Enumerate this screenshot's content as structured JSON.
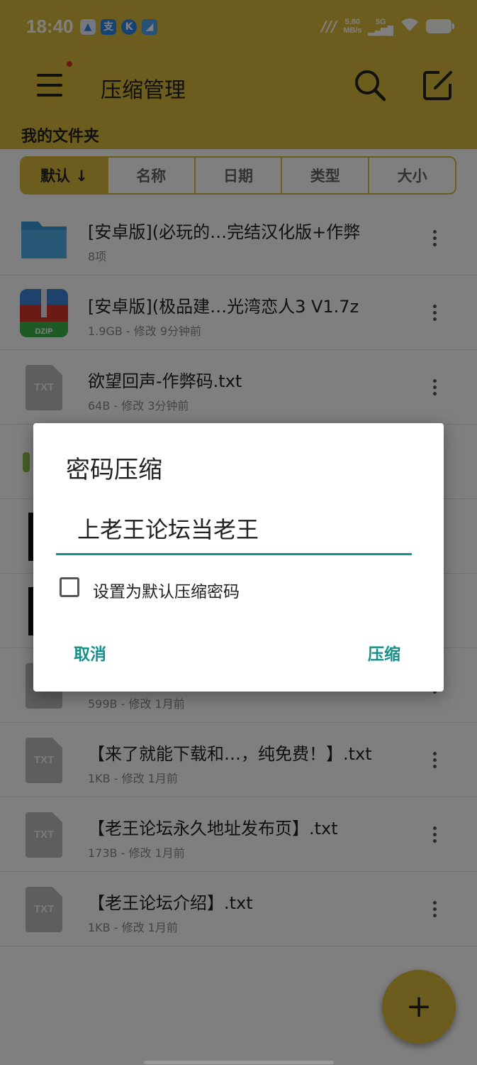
{
  "status_bar": {
    "time": "18:40",
    "apps": [
      "app-icon-1",
      "支",
      "K",
      "app-icon-4"
    ],
    "net_speed": "5.80",
    "net_unit": "MB/s",
    "signal": "5G"
  },
  "toolbar": {
    "title": "压缩管理",
    "menu_icon": "hamburger-icon",
    "search_icon": "search-icon",
    "edit_icon": "edit-icon"
  },
  "section_title": "我的文件夹",
  "sort_tabs": [
    "默认 ↓",
    "名称",
    "日期",
    "类型",
    "大小"
  ],
  "files": [
    {
      "name": "[安卓版](必玩的…完结汉化版+作弊",
      "meta": "8项",
      "type": "folder"
    },
    {
      "name": "[安卓版](极品建…光湾恋人3 V1.7z",
      "meta": "1.9GB - 修改 9分钟前",
      "type": "zip"
    },
    {
      "name": "欲望回声-作弊码.txt",
      "meta": "64B - 修改 3分钟前",
      "type": "txt"
    },
    {
      "name": "",
      "meta": "599B - 修改 1月前",
      "type": "txt"
    },
    {
      "name": "【来了就能下载和…，纯免费！】.txt",
      "meta": "1KB - 修改 1月前",
      "type": "txt"
    },
    {
      "name": "【老王论坛永久地址发布页】.txt",
      "meta": "173B - 修改 1月前",
      "type": "txt"
    },
    {
      "name": "【老王论坛介绍】.txt",
      "meta": "1KB - 修改 1月前",
      "type": "txt"
    }
  ],
  "zip_label": "DZIP",
  "txt_label": "TXT",
  "fab_label": "+",
  "dialog": {
    "title": "密码压缩",
    "password": "上老王论坛当老王",
    "checkbox_label": "设置为默认压缩密码",
    "checkbox_checked": false,
    "cancel": "取消",
    "confirm": "压缩"
  },
  "colors": {
    "accent": "#d8b93a",
    "dialog_accent": "#17908a"
  }
}
